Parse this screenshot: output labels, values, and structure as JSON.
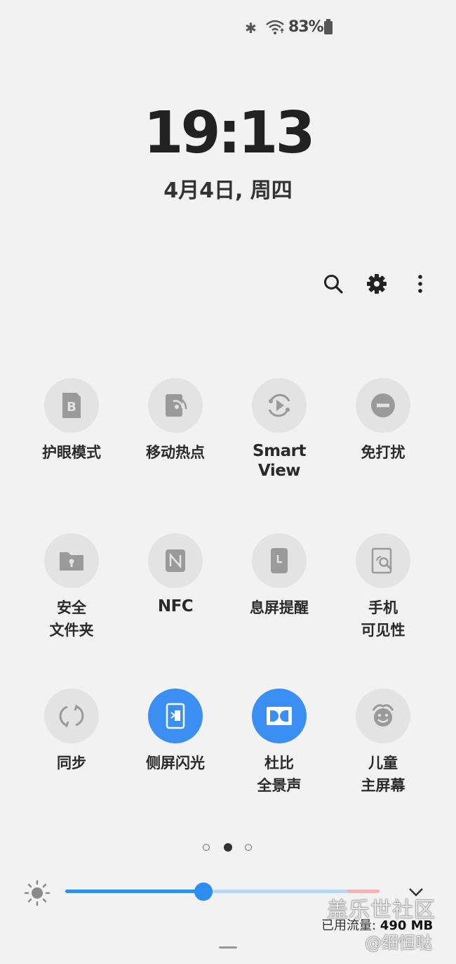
{
  "status_bar": {
    "battery_text": "83%",
    "bluetooth_icon": "bluetooth-icon",
    "wifi_icon": "wifi-icon",
    "battery_icon": "battery-icon"
  },
  "clock": {
    "time": "19:13",
    "date": "4月4日, 周四"
  },
  "toolbar": {
    "icons": [
      "search-icon",
      "gear-icon",
      "more-vert-icon"
    ]
  },
  "tiles": [
    {
      "label": "护眼模式",
      "icon": "eye-comfort-icon",
      "on": false
    },
    {
      "label": "移动热点",
      "icon": "hotspot-icon",
      "on": false
    },
    {
      "label": "Smart\nView",
      "icon": "smart-view-icon",
      "on": false
    },
    {
      "label": "免打扰",
      "icon": "do-not-disturb-icon",
      "on": false
    },
    {
      "label": "安全\n文件夹",
      "icon": "secure-folder-icon",
      "on": false
    },
    {
      "label": "NFC",
      "icon": "nfc-icon",
      "on": false
    },
    {
      "label": "息屏提醒",
      "icon": "always-on-display-icon",
      "on": false
    },
    {
      "label": "手机\n可见性",
      "icon": "nearby-scanning-icon",
      "on": false
    },
    {
      "label": "同步",
      "icon": "sync-icon",
      "on": false
    },
    {
      "label": "侧屏闪光",
      "icon": "edge-lighting-icon",
      "on": true
    },
    {
      "label": "杜比\n全景声",
      "icon": "dolby-atmos-icon",
      "on": true
    },
    {
      "label": "儿童\n主屏幕",
      "icon": "kids-home-icon",
      "on": false
    }
  ],
  "page_indicator": {
    "current": 2,
    "total": 3
  },
  "brightness": {
    "level_fraction": 0.44,
    "accent": "#2d8ef0"
  },
  "data_usage": {
    "label": "已用流量: ",
    "value": "490 MB"
  },
  "watermark": {
    "line1": "盖乐世社区",
    "line2": "@细恒哒"
  },
  "colors": {
    "background": "#f2f2f2",
    "tile_off": "#e3e3e3",
    "tile_on": "#3b8ff3"
  }
}
